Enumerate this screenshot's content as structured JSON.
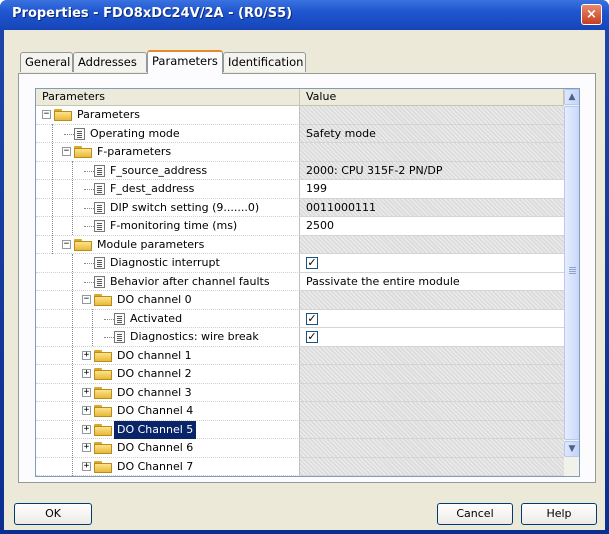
{
  "window": {
    "title": "Properties - FDO8xDC24V/2A - (R0/S5)",
    "close_glyph": "×"
  },
  "tabs": [
    {
      "label": "General",
      "active": false
    },
    {
      "label": "Addresses",
      "active": false
    },
    {
      "label": "Parameters",
      "active": true
    },
    {
      "label": "Identification",
      "active": false
    }
  ],
  "grid": {
    "col_parameters": "Parameters",
    "col_value": "Value",
    "rows": [
      {
        "label": "Parameters",
        "icon": "folder-open-icon",
        "expander": "−",
        "value": "",
        "value_style": "gray",
        "selected": false
      },
      {
        "label": "Operating mode",
        "icon": "parameter-icon",
        "value": "Safety mode",
        "value_style": "gray",
        "selected": false
      },
      {
        "label": "F-parameters",
        "icon": "folder-open-icon",
        "expander": "−",
        "value": "",
        "value_style": "gray",
        "selected": false
      },
      {
        "label": "F_source_address",
        "icon": "parameter-icon",
        "value": "2000: CPU 315F-2 PN/DP",
        "value_style": "gray",
        "selected": false
      },
      {
        "label": "F_dest_address",
        "icon": "parameter-icon",
        "value": "199",
        "value_style": "white",
        "selected": false
      },
      {
        "label": "DIP switch setting (9.......0)",
        "icon": "parameter-icon",
        "value": "0011000111",
        "value_style": "gray",
        "selected": false
      },
      {
        "label": "F-monitoring time (ms)",
        "icon": "parameter-icon",
        "value": "2500",
        "value_style": "white",
        "selected": false
      },
      {
        "label": "Module parameters",
        "icon": "folder-open-icon",
        "expander": "−",
        "value": "",
        "value_style": "gray",
        "selected": false
      },
      {
        "label": "Diagnostic interrupt",
        "icon": "parameter-icon",
        "value": "",
        "checkbox": true,
        "value_style": "white",
        "selected": false
      },
      {
        "label": "Behavior after channel faults",
        "icon": "parameter-icon",
        "value": "Passivate the entire module",
        "value_style": "white",
        "selected": false
      },
      {
        "label": "DO channel 0",
        "icon": "folder-open-icon",
        "expander": "−",
        "value": "",
        "value_style": "gray",
        "selected": false
      },
      {
        "label": "Activated",
        "icon": "parameter-icon",
        "value": "",
        "checkbox": true,
        "value_style": "white",
        "selected": false
      },
      {
        "label": "Diagnostics: wire break",
        "icon": "parameter-icon",
        "value": "",
        "checkbox": true,
        "value_style": "white",
        "selected": false
      },
      {
        "label": "DO channel 1",
        "icon": "folder-icon",
        "expander": "+",
        "value": "",
        "value_style": "gray",
        "selected": false
      },
      {
        "label": "DO channel 2",
        "icon": "folder-icon",
        "expander": "+",
        "value": "",
        "value_style": "gray",
        "selected": false
      },
      {
        "label": "DO channel 3",
        "icon": "folder-icon",
        "expander": "+",
        "value": "",
        "value_style": "gray",
        "selected": false
      },
      {
        "label": "DO Channel 4",
        "icon": "folder-icon",
        "expander": "+",
        "value": "",
        "value_style": "gray",
        "selected": false
      },
      {
        "label": "DO Channel 5",
        "icon": "folder-icon",
        "expander": "+",
        "value": "",
        "value_style": "gray",
        "selected": true
      },
      {
        "label": "DO Channel 6",
        "icon": "folder-icon",
        "expander": "+",
        "value": "",
        "value_style": "gray",
        "selected": false
      },
      {
        "label": "DO Channel 7",
        "icon": "folder-icon",
        "expander": "+",
        "value": "",
        "value_style": "gray",
        "selected": false
      }
    ],
    "check_glyph": "✓",
    "scroll_up_glyph": "▲",
    "scroll_down_glyph": "▼"
  },
  "buttons": {
    "ok": "OK",
    "cancel": "Cancel",
    "help": "Help"
  },
  "colors": {
    "selection": "#0a246a",
    "title_bar": "#1f55cf",
    "dialog_face": "#ece9d8"
  }
}
